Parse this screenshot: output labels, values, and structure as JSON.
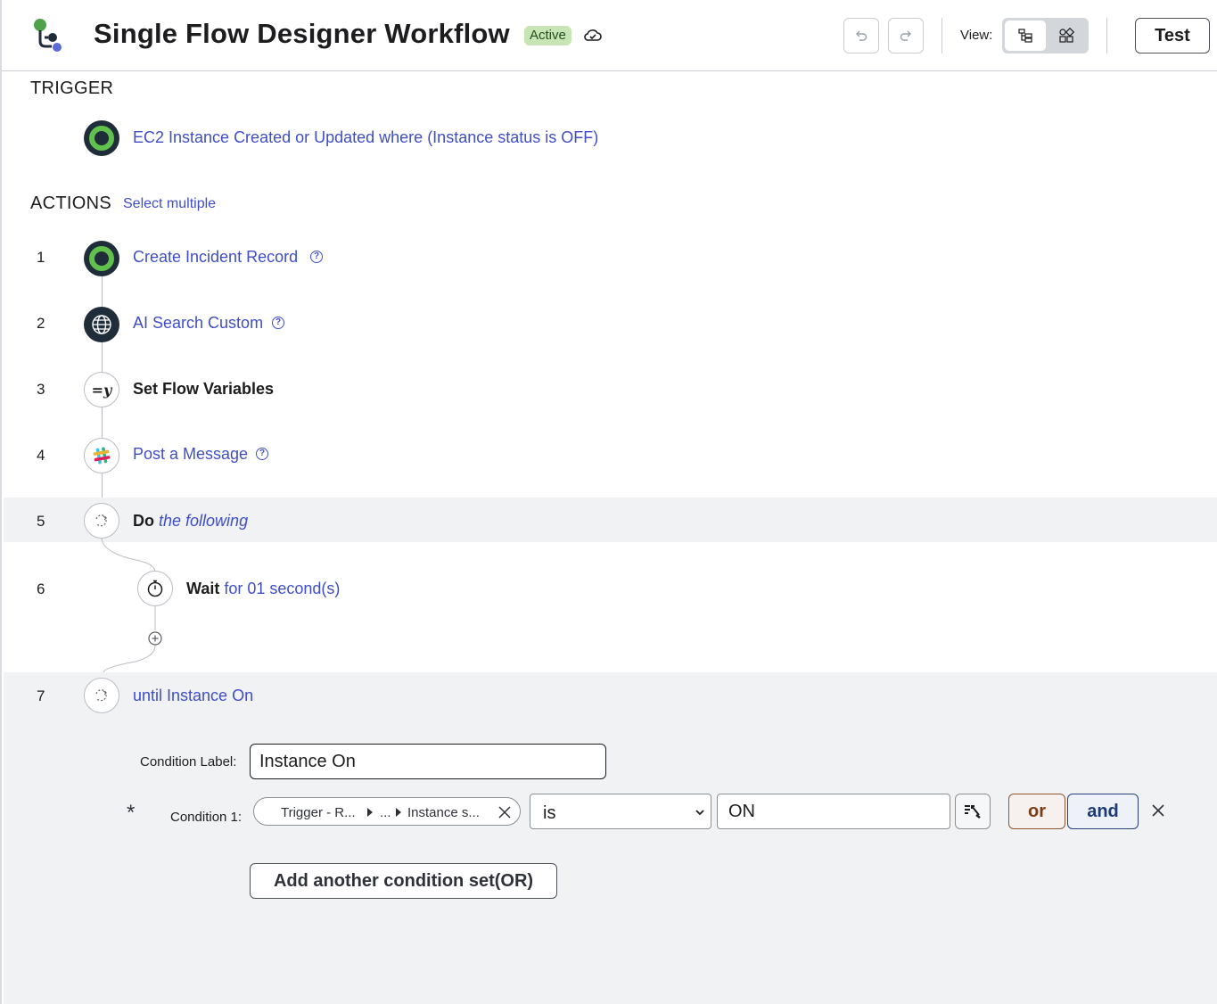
{
  "header": {
    "title": "Single Flow Designer Workflow",
    "status_badge": "Active",
    "view_label": "View:",
    "test_label": "Test",
    "icons": [
      "flow-logo-icon",
      "cloud-sync-icon",
      "undo-icon",
      "redo-icon",
      "tree-view-icon",
      "canvas-view-icon"
    ]
  },
  "trigger": {
    "section_label": "TRIGGER",
    "description": "EC2 Instance Created or Updated where (Instance status is OFF)"
  },
  "actions": {
    "section_label": "ACTIONS",
    "select_multiple": "Select multiple",
    "steps": [
      {
        "num": "1",
        "label": "Create Incident Record",
        "icon": "servicenow-icon"
      },
      {
        "num": "2",
        "label": "AI Search Custom",
        "icon": "globe-icon"
      },
      {
        "num": "3",
        "label": "Set Flow Variables",
        "icon": "variable-icon",
        "icon_text": "=y"
      },
      {
        "num": "4",
        "label": "Post a Message",
        "icon": "slack-icon"
      },
      {
        "num": "5",
        "label_bold": "Do",
        "label_rest": "the following",
        "icon": "loop-icon"
      },
      {
        "num": "6",
        "label_bold": "Wait",
        "label_rest": "for 01 second(s)",
        "icon": "timer-icon"
      },
      {
        "num": "7",
        "label": "until Instance On",
        "icon": "loop-icon"
      }
    ]
  },
  "condition": {
    "label_caption": "Condition Label:",
    "label_value": "Instance On",
    "condition1_caption": "Condition 1:",
    "required_mark": "*",
    "pill_part1": "Trigger - R...",
    "pill_part2": "...",
    "pill_part3": "Instance s...",
    "operator": "is",
    "value": "ON",
    "or_label": "or",
    "and_label": "and",
    "add_set_label": "Add another condition set(OR)"
  },
  "colors": {
    "link": "#3f4ec8",
    "badge_bg": "#c8e6b5",
    "green_ring": "#62c04d",
    "dark_icon": "#1f2d3b",
    "highlight_row": "#f1f2f4"
  }
}
